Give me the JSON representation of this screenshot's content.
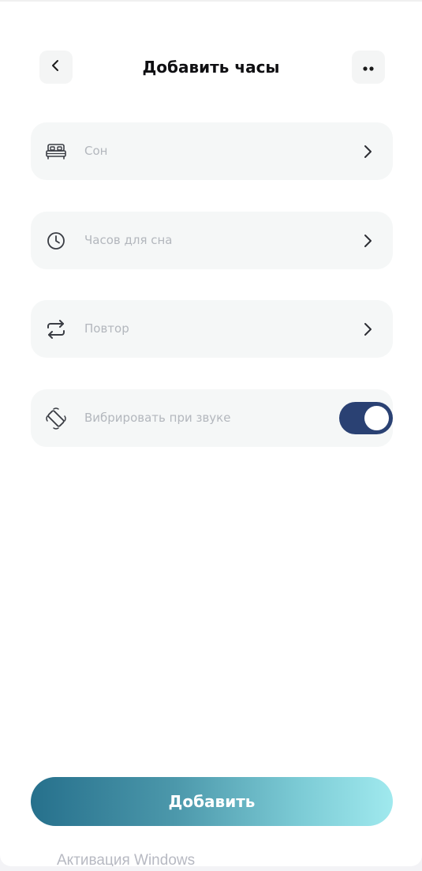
{
  "header": {
    "title": "Добавить часы",
    "back_icon": "chevron-left-icon",
    "more_icon": "more-dots-icon"
  },
  "settings": {
    "rows": [
      {
        "label": "Сон",
        "icon": "bed-icon",
        "action_icon": "chevron-right-icon"
      },
      {
        "label": "Часов для сна",
        "icon": "clock-icon",
        "action_icon": "chevron-right-icon"
      },
      {
        "label": "Повтор",
        "icon": "repeat-icon",
        "action_icon": "chevron-right-icon"
      },
      {
        "label": "Вибрировать при звуке",
        "icon": "vibrate-phone-icon",
        "toggle_on": true
      }
    ]
  },
  "footer": {
    "add_label": "Добавить"
  },
  "watermark": {
    "text": "Активация Windows"
  },
  "colors": {
    "toggle_on": "#2a4173",
    "row_bg": "#f5f7f7",
    "label_muted": "#b3b7bd",
    "button_gradient_start": "#26708c",
    "button_gradient_end": "#a0e9ee"
  }
}
